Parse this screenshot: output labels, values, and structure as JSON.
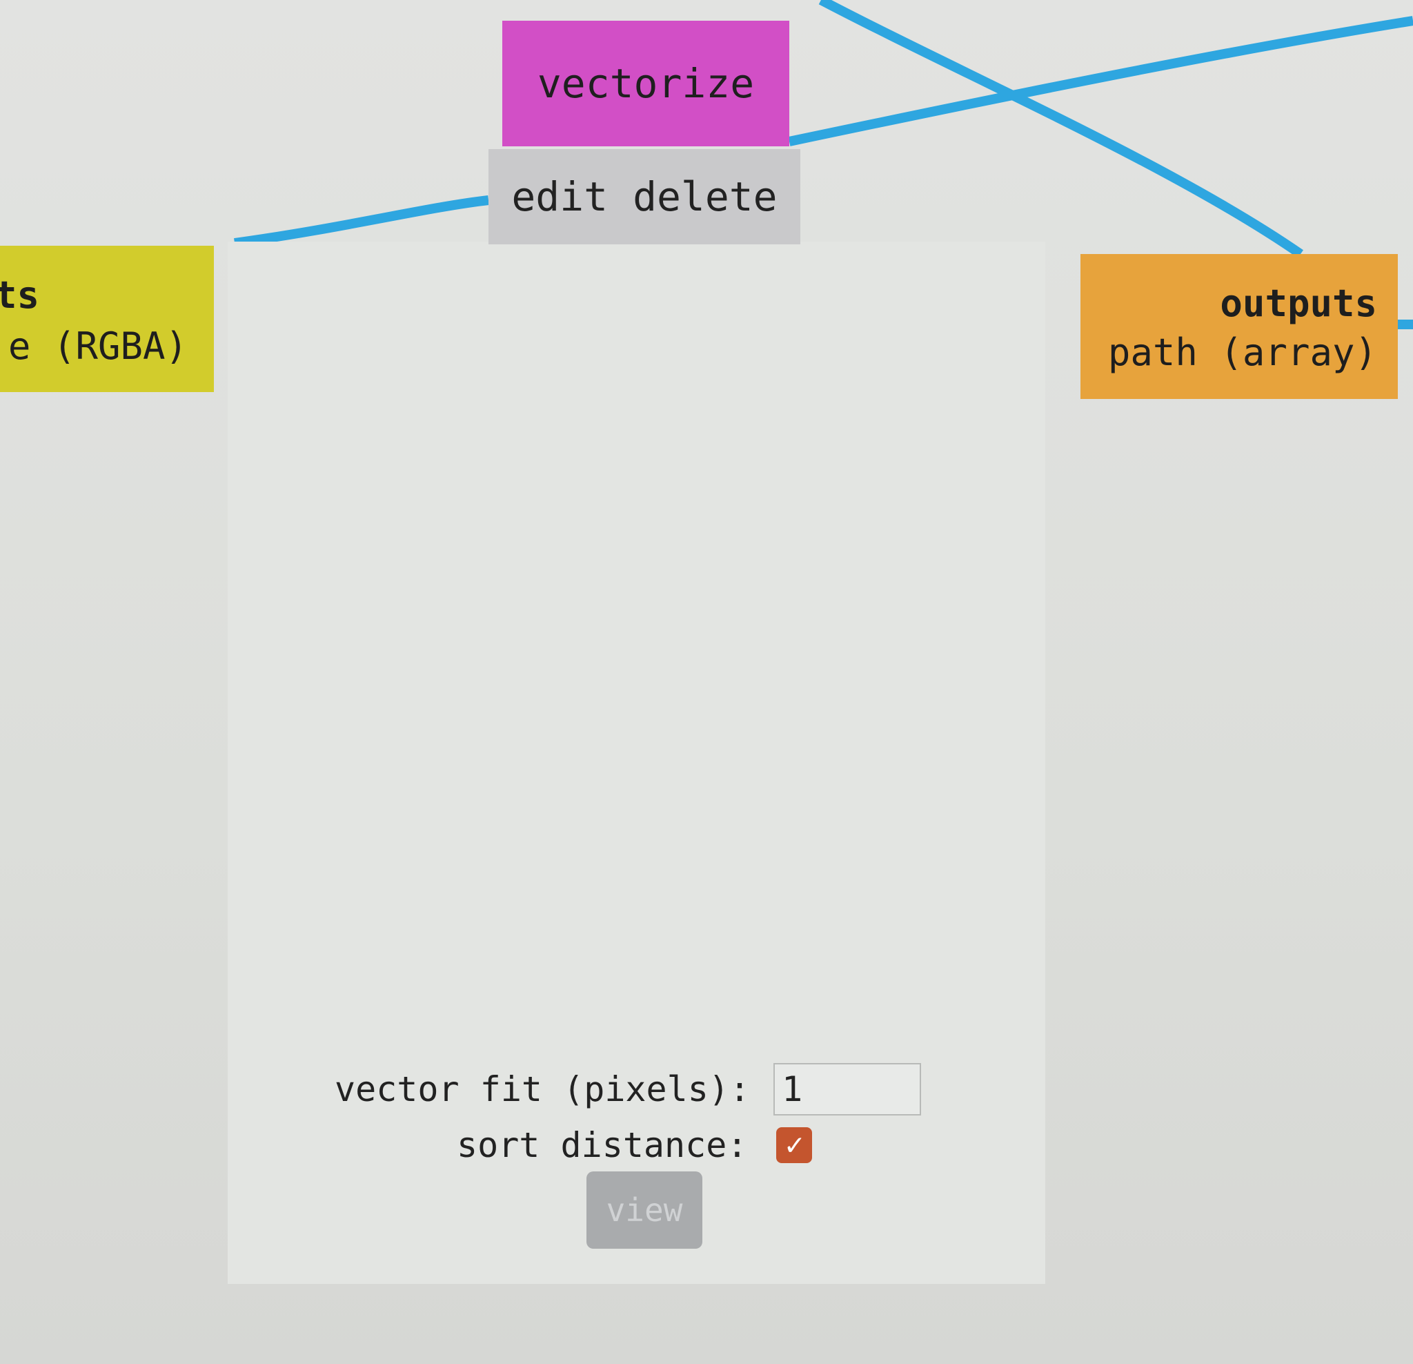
{
  "node": {
    "title": "vectorize",
    "actions": {
      "edit_label": "edit",
      "delete_label": "delete"
    },
    "color": "#d24fc6"
  },
  "inputs_port": {
    "heading": "ts",
    "type_label": "e (RGBA)",
    "color": "#d2cc2c"
  },
  "outputs_port": {
    "heading": "outputs",
    "type_label": "path (array)",
    "color": "#e7a33c"
  },
  "params": {
    "vector_fit_label": "vector fit (pixels):",
    "vector_fit_value": "1",
    "sort_distance_label": "sort distance:",
    "sort_distance_checked": true,
    "checkmark_glyph": "✓",
    "view_label": "view"
  },
  "wire_color": "#2ea6e0"
}
